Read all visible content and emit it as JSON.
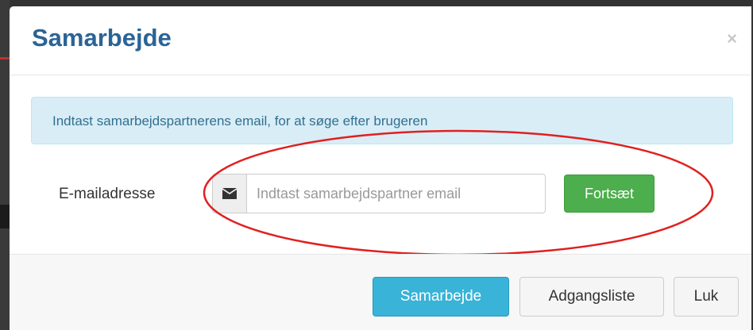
{
  "modal": {
    "title": "Samarbejde",
    "close_glyph": "×",
    "info_text": "Indtast samarbejdspartnerens email, for at søge efter brugeren",
    "email_label": "E-mailadresse",
    "email_value": "",
    "email_placeholder": "Indtast samarbejdspartner email",
    "email_icon": "envelope-icon",
    "continue_label": "Fortsæt"
  },
  "footer": {
    "collaborate_label": "Samarbejde",
    "access_list_label": "Adgangsliste",
    "close_label": "Luk"
  },
  "colors": {
    "title": "#2a6496",
    "info_bg": "#d9edf7",
    "info_text": "#31708f",
    "continue_bg": "#4cae4c",
    "primary_bg": "#39b3d7",
    "annotation_ellipse": "#e02020"
  }
}
